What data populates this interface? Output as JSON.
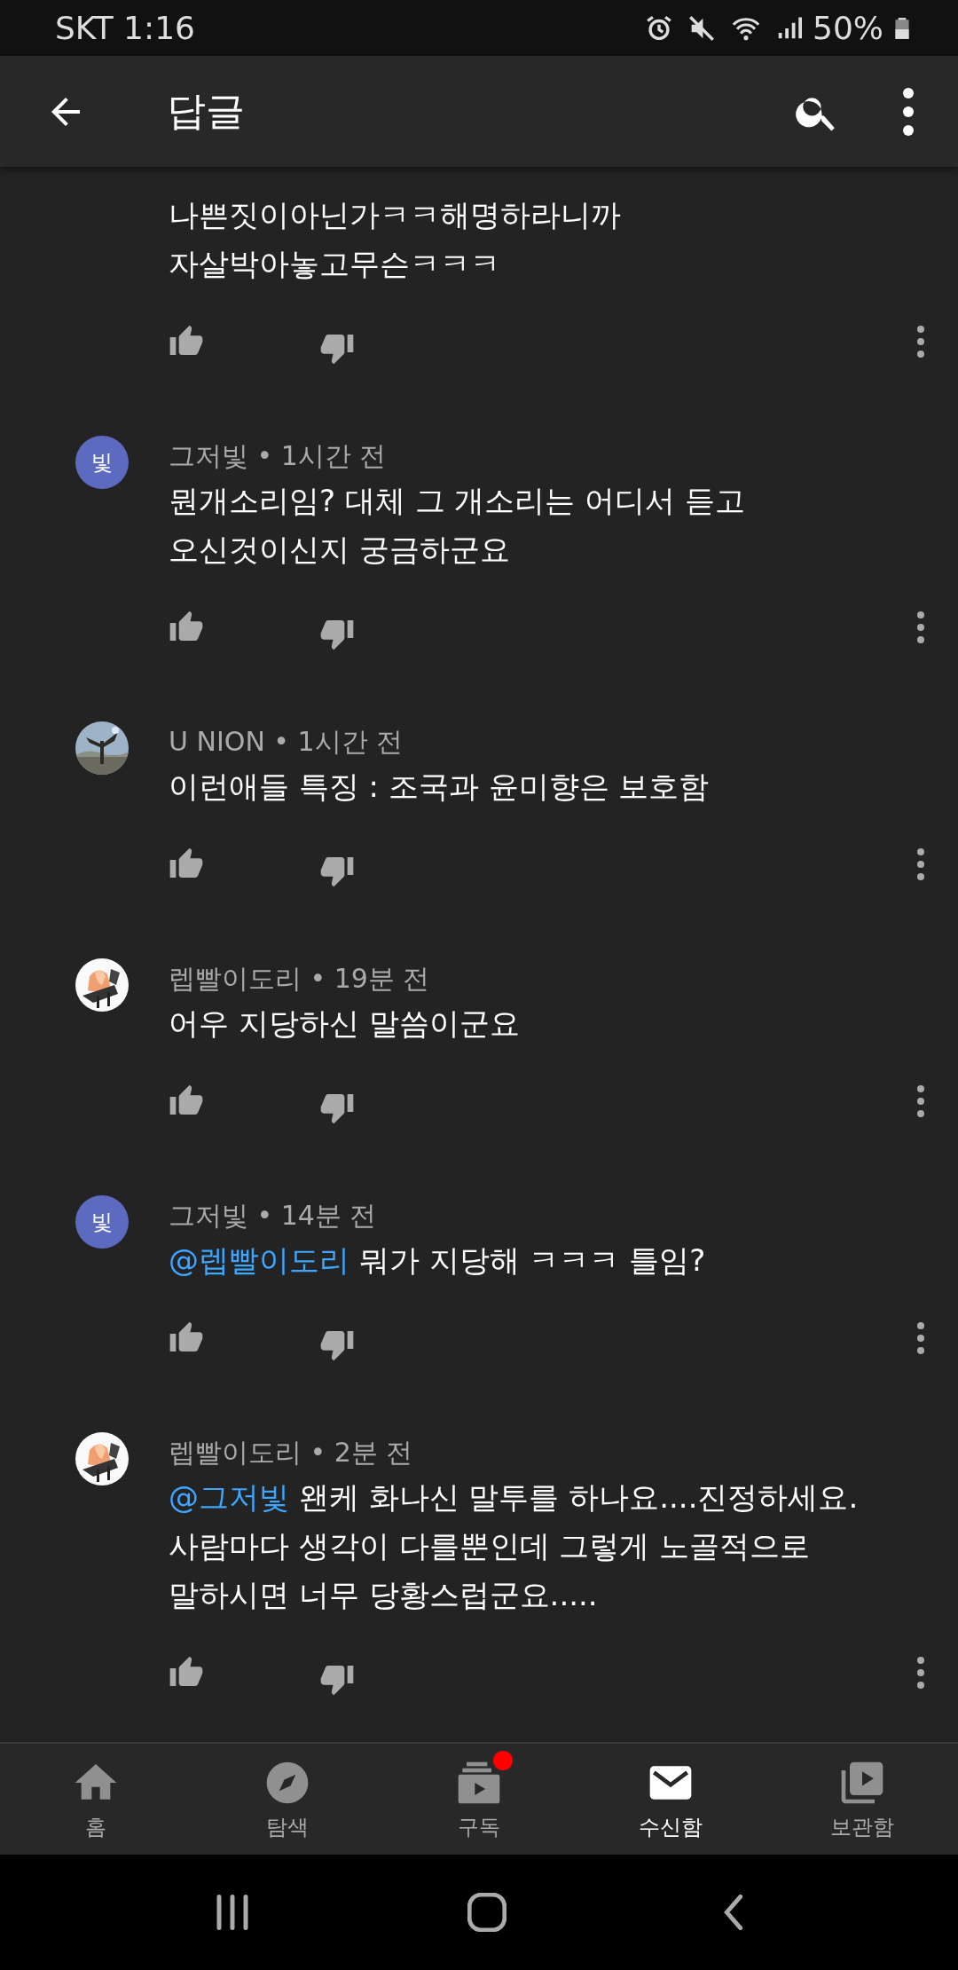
{
  "status_bar": {
    "carrier_time": "SKT 1:16",
    "battery": "50%"
  },
  "app_bar": {
    "title": "답글"
  },
  "comments": [
    {
      "lines": [
        "나쁜짓이아닌가ㅋㅋ해명하라니까",
        "자살박아놓고무슨ㅋㅋㅋ"
      ]
    },
    {
      "avatar": {
        "kind": "letter",
        "letter": "빛"
      },
      "author": "그저빛",
      "separator": "•",
      "time": "1시간 전",
      "lines": [
        "뭔개소리임? 대체 그 개소리는 어디서 듣고",
        "오신것이신지 궁금하군요"
      ]
    },
    {
      "avatar": {
        "kind": "picture"
      },
      "author": "U NION",
      "separator": "•",
      "time": "1시간 전",
      "lines": [
        "이런애들 특징 : 조국과 윤미향은 보호함"
      ]
    },
    {
      "avatar": {
        "kind": "picture"
      },
      "author": "렙빨이도리",
      "separator": "•",
      "time": "19분 전",
      "lines": [
        "어우 지당하신 말씀이군요"
      ]
    },
    {
      "avatar": {
        "kind": "letter",
        "letter": "빛"
      },
      "author": "그저빛",
      "separator": "•",
      "time": "14분 전",
      "mention": "@렙빨이도리",
      "lines": [
        "뭐가 지당해 ㅋㅋㅋ 틀임?"
      ]
    },
    {
      "avatar": {
        "kind": "picture"
      },
      "author": "렙빨이도리",
      "separator": "•",
      "time": "2분 전",
      "mention": "@그저빛",
      "lines": [
        "왠케 화나신 말투를 하나요....진정하세요.",
        "사람마다 생각이 다를뿐인데 그렇게 노골적으로",
        "말하시면 너무 당황스럽군요....."
      ]
    }
  ],
  "bottom_nav": [
    {
      "label": "홈",
      "selected": false,
      "badge": false
    },
    {
      "label": "탐색",
      "selected": false,
      "badge": false
    },
    {
      "label": "구독",
      "selected": false,
      "badge": true
    },
    {
      "label": "수신함",
      "selected": true,
      "badge": false
    },
    {
      "label": "보관함",
      "selected": false,
      "badge": false
    }
  ]
}
